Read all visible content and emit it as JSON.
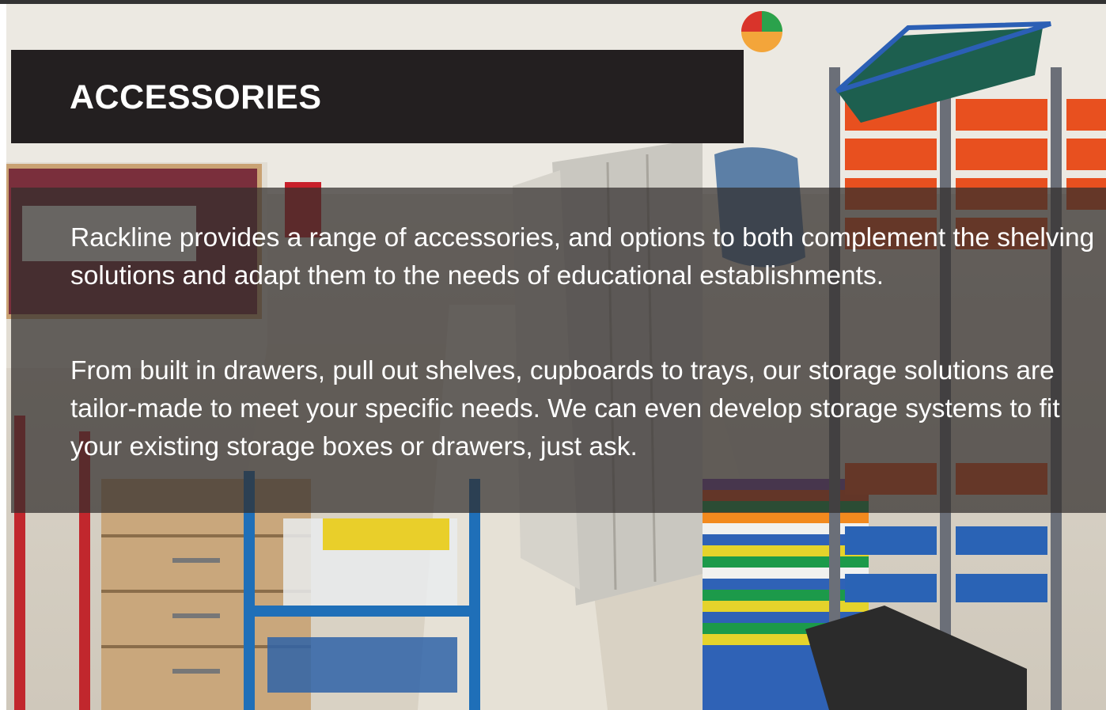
{
  "heading": {
    "title": "ACCESSORIES"
  },
  "body": {
    "paragraph_1": "Rackline provides a range of accessories, and options to both complement the shelving solutions and adapt them to the needs of educational establishments.",
    "paragraph_2": "From built in drawers, pull out shelves, cupboards to trays, our storage solutions are tailor-made to meet your specific needs.  We can even develop storage systems to fit your existing storage boxes or drawers, just ask."
  },
  "background_photo": {
    "subject": "school storage room with mobile shelving, colourful trays and trolleys",
    "icon": "photo-background"
  },
  "colors": {
    "title_bar": "#231f20",
    "text_overlay": "rgba(50,46,44,0.72)",
    "text": "#ffffff"
  }
}
